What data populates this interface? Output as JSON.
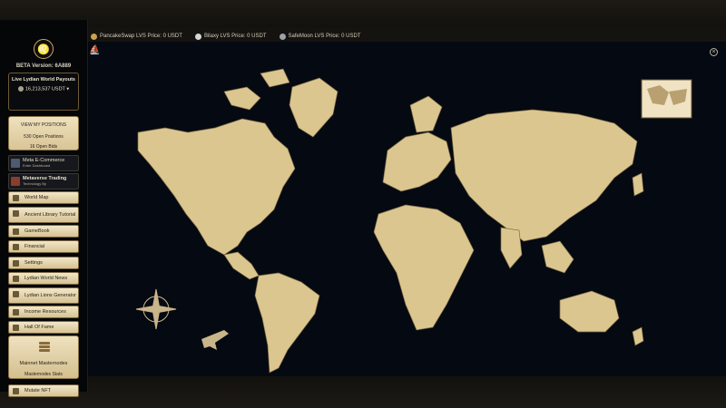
{
  "sidebar": {
    "beta_version": "BETA Version: 6A889",
    "payouts_title": "Live Lydian World Payouts",
    "payouts_amount": "16,213,537 USDT",
    "positions_title": "VIEW MY POSITIONS",
    "open_positions": "530 Open Positions",
    "open_bids": "16 Open Bids",
    "meta_ecommerce": "Meta E-Commerce",
    "enter_dashboard": "Enter Dashboard",
    "metaverse_trading": "Metaverse Trading",
    "technology_by": "Technology By",
    "items": [
      {
        "label": "World Map"
      },
      {
        "label": "Ancient Library Tutorial"
      },
      {
        "label": "GameBook"
      },
      {
        "label": "Financial"
      },
      {
        "label": "Settings"
      },
      {
        "label": "Lydian World News"
      },
      {
        "label": "Lydian Lions Generator"
      },
      {
        "label": "Income Resources"
      },
      {
        "label": "Hall Of Fame"
      }
    ],
    "mainnet_masternodes": "Mainnet Masternodes",
    "masternodes_stats": "Masternodes Stats",
    "mutate_nft": "Mutate NFT"
  },
  "ticker": [
    {
      "label": "PancakeSwap LVS Price: 0 USDT",
      "color": "#c9a24a"
    },
    {
      "label": "Bilaxy LVS Price: 0 USDT",
      "color": "#d6d6d6"
    },
    {
      "label": "SafeMoon LVS Price: 0 USDT",
      "color": "#9aa3ad"
    }
  ],
  "close_icon": "close-icon",
  "colors": {
    "land": "#dcc690",
    "ocean": "#050911",
    "border": "#7d6b45",
    "accent": "#c8a96a"
  }
}
